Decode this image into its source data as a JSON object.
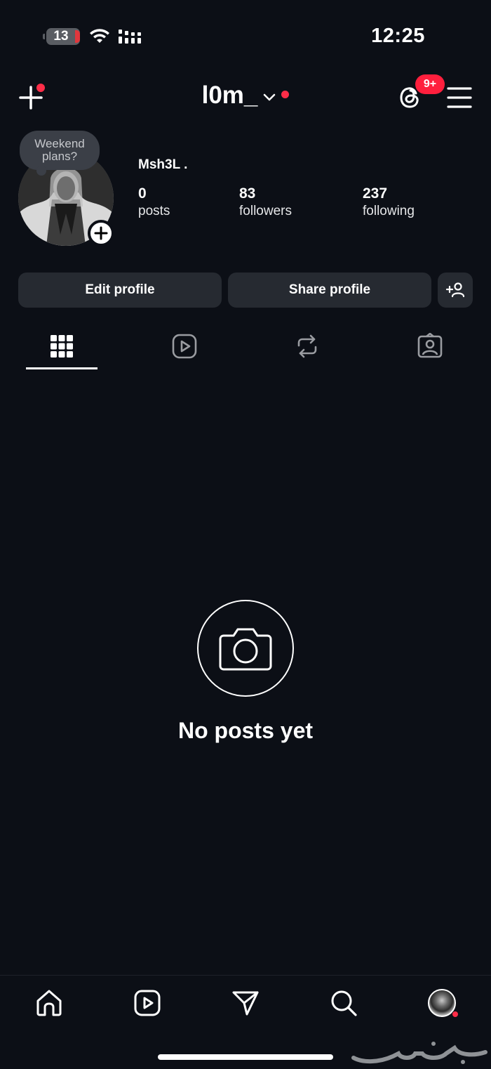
{
  "status_bar": {
    "battery_level": "13",
    "time": "12:25"
  },
  "header": {
    "username": "l0m_",
    "threads_badge": "9+"
  },
  "profile": {
    "note": "Weekend plans?",
    "display_name": "Msh3L .",
    "stats": {
      "posts": {
        "value": "0",
        "label": "posts"
      },
      "followers": {
        "value": "83",
        "label": "followers"
      },
      "following": {
        "value": "237",
        "label": "following"
      }
    }
  },
  "actions": {
    "edit_profile": "Edit profile",
    "share_profile": "Share profile"
  },
  "tabs": [
    {
      "icon": "grid-icon",
      "active": true
    },
    {
      "icon": "reels-icon",
      "active": false
    },
    {
      "icon": "reposts-icon",
      "active": false
    },
    {
      "icon": "tagged-icon",
      "active": false
    }
  ],
  "empty_state": {
    "message": "No posts yet"
  },
  "bottom_nav": [
    "home-icon",
    "reels-icon",
    "messages-icon",
    "search-icon",
    "profile-avatar"
  ],
  "colors": {
    "background": "#0c0f16",
    "button": "#262a31",
    "notification_red": "#ff2d48"
  }
}
